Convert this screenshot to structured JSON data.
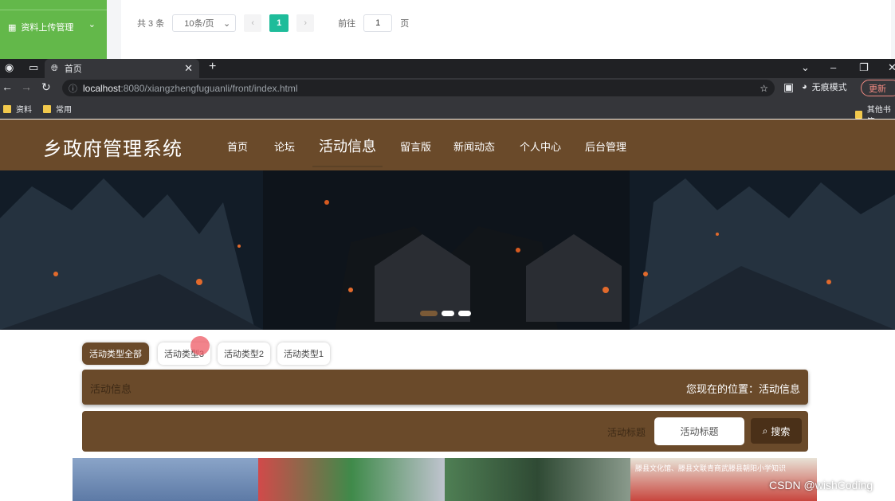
{
  "admin": {
    "sidebar_item": "资料上传管理",
    "pager": {
      "total": "共 3 条",
      "page_size": "10条/页",
      "current_page": "1",
      "goto_label": "前往",
      "goto_value": "1",
      "page_unit": "页"
    }
  },
  "browser": {
    "tab_title": "首页",
    "url_host": "localhost",
    "url_rest": ":8080/xiangzhengfuguanli/front/index.html",
    "profile_label": "无痕模式",
    "update_label": "更新",
    "bookmarks": [
      "资料",
      "常用"
    ],
    "other_bookmarks": "其他书签"
  },
  "site": {
    "title": "乡政府管理系统",
    "nav": [
      "首页",
      "论坛",
      "活动信息",
      "留言版",
      "新闻动态",
      "个人中心",
      "后台管理"
    ]
  },
  "filters": [
    "活动类型全部",
    "活动类型3",
    "活动类型2",
    "活动类型1"
  ],
  "breadcrumb": {
    "section": "活动信息",
    "location": "您现在的位置：活动信息"
  },
  "search": {
    "label": "活动标题",
    "placeholder": "活动标题",
    "button": "搜索"
  },
  "thumb_caption": "滕县文化馆、滕县文联青商武滕县朝阳小学知识",
  "watermark": "CSDN @wishCoding"
}
